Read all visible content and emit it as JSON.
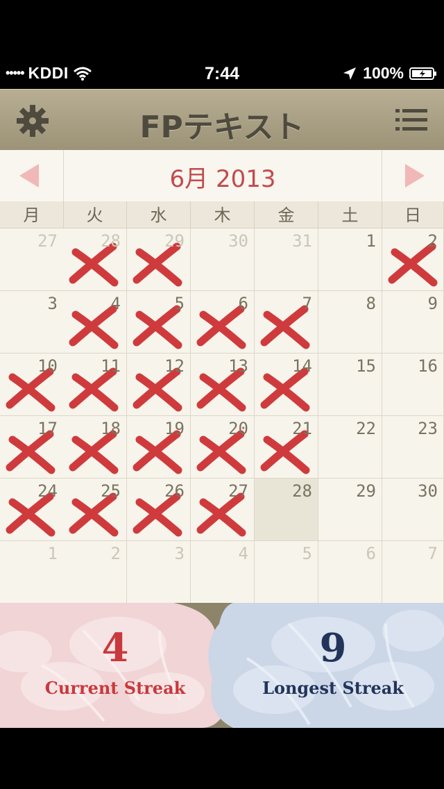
{
  "status": {
    "carrier": "KDDI",
    "time": "7:44",
    "battery": "100%",
    "signal_icon": "signal-dots",
    "wifi_icon": "wifi",
    "location_icon": "location-arrow",
    "battery_icon": "battery-charging"
  },
  "nav": {
    "title": "FPテキスト",
    "left_icon": "gear",
    "right_icon": "list"
  },
  "calendar": {
    "month_label": "6月 2013",
    "weekdays": [
      "月",
      "火",
      "水",
      "木",
      "金",
      "土",
      "日"
    ],
    "weeks": [
      [
        {
          "d": "27",
          "out": true,
          "x": false
        },
        {
          "d": "28",
          "out": true,
          "x": true
        },
        {
          "d": "29",
          "out": true,
          "x": true
        },
        {
          "d": "30",
          "out": true,
          "x": false
        },
        {
          "d": "31",
          "out": true,
          "x": false
        },
        {
          "d": "1",
          "out": false,
          "x": false
        },
        {
          "d": "2",
          "out": false,
          "x": true
        }
      ],
      [
        {
          "d": "3",
          "out": false,
          "x": false
        },
        {
          "d": "4",
          "out": false,
          "x": true
        },
        {
          "d": "5",
          "out": false,
          "x": true
        },
        {
          "d": "6",
          "out": false,
          "x": true
        },
        {
          "d": "7",
          "out": false,
          "x": true
        },
        {
          "d": "8",
          "out": false,
          "x": false
        },
        {
          "d": "9",
          "out": false,
          "x": false
        }
      ],
      [
        {
          "d": "10",
          "out": false,
          "x": true
        },
        {
          "d": "11",
          "out": false,
          "x": true
        },
        {
          "d": "12",
          "out": false,
          "x": true
        },
        {
          "d": "13",
          "out": false,
          "x": true
        },
        {
          "d": "14",
          "out": false,
          "x": true
        },
        {
          "d": "15",
          "out": false,
          "x": false
        },
        {
          "d": "16",
          "out": false,
          "x": false
        }
      ],
      [
        {
          "d": "17",
          "out": false,
          "x": true
        },
        {
          "d": "18",
          "out": false,
          "x": true
        },
        {
          "d": "19",
          "out": false,
          "x": true
        },
        {
          "d": "20",
          "out": false,
          "x": true
        },
        {
          "d": "21",
          "out": false,
          "x": true
        },
        {
          "d": "22",
          "out": false,
          "x": false
        },
        {
          "d": "23",
          "out": false,
          "x": false
        }
      ],
      [
        {
          "d": "24",
          "out": false,
          "x": true
        },
        {
          "d": "25",
          "out": false,
          "x": true
        },
        {
          "d": "26",
          "out": false,
          "x": true
        },
        {
          "d": "27",
          "out": false,
          "x": true
        },
        {
          "d": "28",
          "out": false,
          "x": false,
          "today": true
        },
        {
          "d": "29",
          "out": false,
          "x": false
        },
        {
          "d": "30",
          "out": false,
          "x": false
        }
      ],
      [
        {
          "d": "1",
          "out": true,
          "x": false
        },
        {
          "d": "2",
          "out": true,
          "x": false
        },
        {
          "d": "3",
          "out": true,
          "x": false
        },
        {
          "d": "4",
          "out": true,
          "x": false
        },
        {
          "d": "5",
          "out": true,
          "x": false
        },
        {
          "d": "6",
          "out": true,
          "x": false
        },
        {
          "d": "7",
          "out": true,
          "x": false
        }
      ]
    ]
  },
  "streaks": {
    "current": {
      "value": "4",
      "label": "Current Streak",
      "color": "#c9383c"
    },
    "longest": {
      "value": "9",
      "label": "Longest Streak",
      "color": "#22345a"
    }
  },
  "colors": {
    "accent": "#c24a4c",
    "xmark": "#cf3b3d"
  }
}
